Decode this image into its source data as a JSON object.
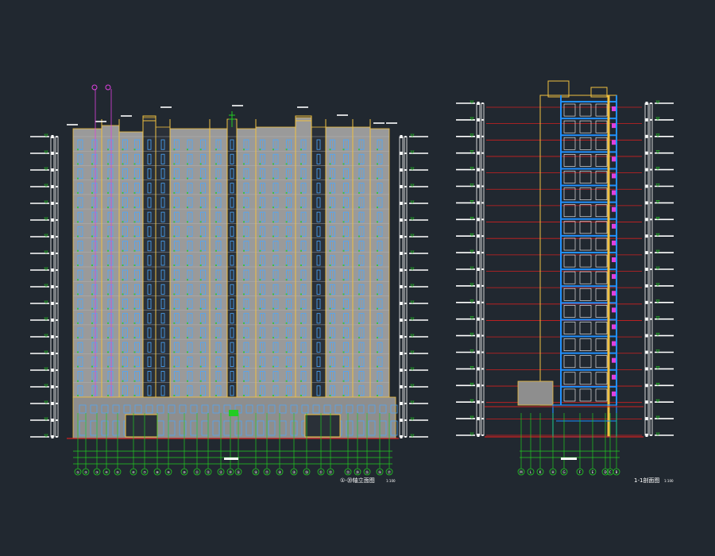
{
  "drawing": {
    "background": "#212830",
    "colors": {
      "wall": "#e8e8e8",
      "facade": "#9a9a9a",
      "frame": "#f0c040",
      "window_blue": "#4aa8ff",
      "window_green": "#40c040",
      "axis_green": "#22cc22",
      "axis_red": "#d02020",
      "slab_cyan": "#2090ff",
      "magenta": "#e040e0",
      "white": "#ffffff"
    },
    "elevation": {
      "title": "①-⑳轴立面图",
      "scale": "1:100",
      "axis_labels": [
        "①",
        "②",
        "③",
        "④",
        "⑤",
        "⑥",
        "⑦",
        "⑧",
        "⑨",
        "⑩",
        "⑪",
        "⑫",
        "⑬",
        "⑭",
        "⑮",
        "⑯",
        "⑰",
        "⑱",
        "⑲",
        "⑳",
        "㉑",
        "㉒",
        "㉓",
        "㉔",
        "㉕",
        "㉖",
        "㉗",
        "㉘"
      ],
      "floors": 18
    },
    "section": {
      "title": "1-1剖面图",
      "scale": "1:100",
      "axis_labels": [
        "M",
        "L",
        "K",
        "H",
        "G",
        "F",
        "E",
        "D",
        "C",
        "B",
        "A"
      ],
      "floors": 18
    }
  }
}
